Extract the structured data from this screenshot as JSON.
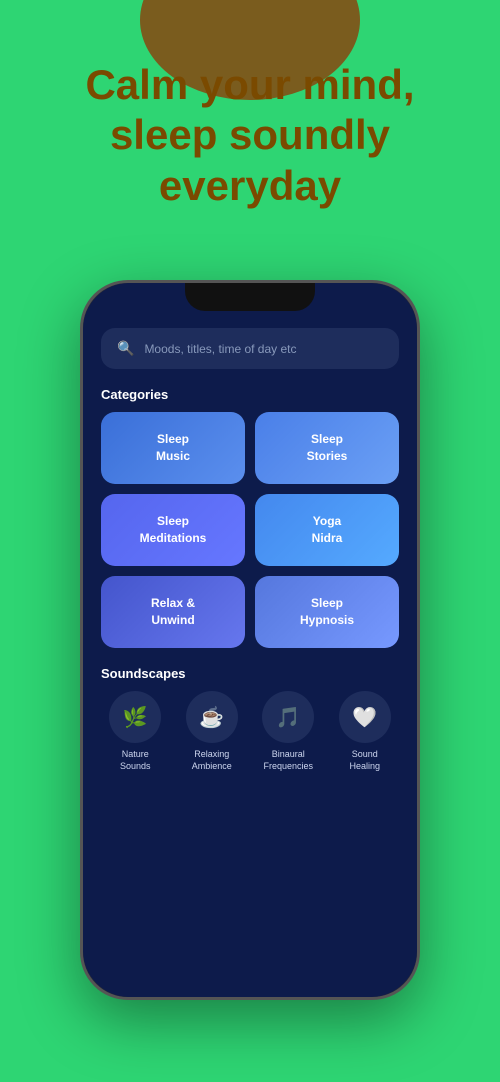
{
  "hero": {
    "title_line1": "Calm your mind,",
    "title_line2": "sleep soundly",
    "title_line3": "everyday"
  },
  "search": {
    "placeholder": "Moods, titles, time of day etc"
  },
  "categories_title": "Categories",
  "categories": [
    {
      "id": "sleep-music",
      "label": "Sleep\nMusic",
      "style": "card-sleep-music"
    },
    {
      "id": "sleep-stories",
      "label": "Sleep\nStories",
      "style": "card-sleep-stories"
    },
    {
      "id": "sleep-meditations",
      "label": "Sleep\nMeditations",
      "style": "card-sleep-meditations"
    },
    {
      "id": "yoga-nidra",
      "label": "Yoga\nNidra",
      "style": "card-yoga-nidra"
    },
    {
      "id": "relax-unwind",
      "label": "Relax &\nUnwind",
      "style": "card-relax-unwind"
    },
    {
      "id": "sleep-hypnosis",
      "label": "Sleep\nHypnosis",
      "style": "card-sleep-hypnosis"
    }
  ],
  "soundscapes_title": "Soundscapes",
  "soundscapes": [
    {
      "id": "nature-sounds",
      "icon": "🌿",
      "label": "Nature\nSounds"
    },
    {
      "id": "relaxing-ambience",
      "icon": "☕",
      "label": "Relaxing\nAmbience"
    },
    {
      "id": "binaural-frequencies",
      "icon": "🎵",
      "label": "Binaural\nFrequencies"
    },
    {
      "id": "sound-healing",
      "icon": "🤍",
      "label": "Sound\nHealing"
    }
  ]
}
